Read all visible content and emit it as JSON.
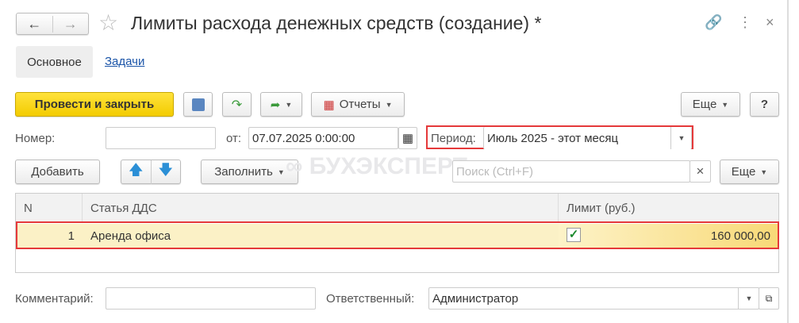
{
  "header": {
    "title": "Лимиты расхода денежных средств (создание) *"
  },
  "tabs": [
    {
      "label": "Основное"
    },
    {
      "label": "Задачи"
    }
  ],
  "toolbar": {
    "post_close": "Провести и закрыть",
    "reports": "Отчеты",
    "more": "Еще",
    "help": "?"
  },
  "form": {
    "number_label": "Номер:",
    "number_value": "",
    "date_label": "от:",
    "date_value": "07.07.2025  0:00:00",
    "period_label": "Период:",
    "period_value": "Июль 2025 - этот месяц"
  },
  "table_toolbar": {
    "add": "Добавить",
    "fill": "Заполнить",
    "search_placeholder": "Поиск (Ctrl+F)",
    "more": "Еще"
  },
  "watermark": "БУХЭКСПЕРТ",
  "table": {
    "columns": [
      "N",
      "Статья ДДС",
      "Лимит (руб.)"
    ],
    "rows": [
      {
        "n": "1",
        "item": "Аренда офиса",
        "checked": true,
        "limit": "160 000,00"
      }
    ]
  },
  "footer": {
    "comment_label": "Комментарий:",
    "comment_value": "",
    "responsible_label": "Ответственный:",
    "responsible_value": "Администратор"
  }
}
